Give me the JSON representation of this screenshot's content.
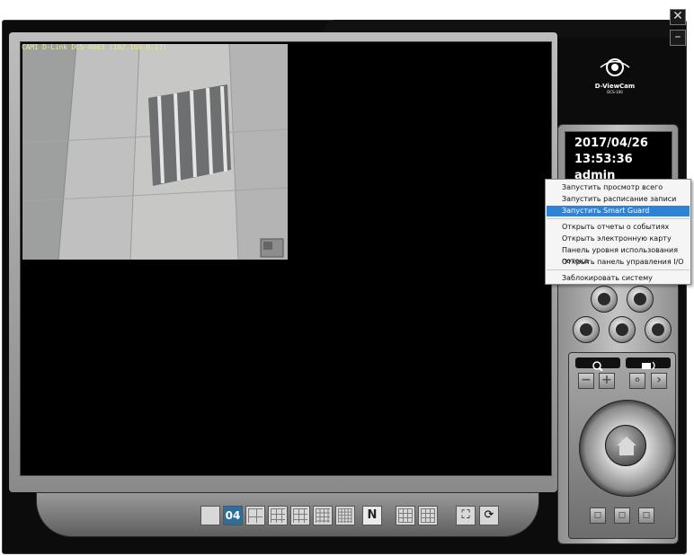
{
  "camera": {
    "label": "CAM1 D-Link DCS-4603 (192.168.0.17)"
  },
  "logo": {
    "name": "D-ViewCam",
    "model": "DCS-100"
  },
  "info": {
    "date": "2017/04/26",
    "time": "13:53:36",
    "user": "admin"
  },
  "menu": {
    "items": [
      "Запустить просмотр всего",
      "Запустить расписание записи",
      "Запустить Smart Guard",
      "Открыть отчеты о событиях",
      "Открыть электронную карту",
      "Панель уровня использования потока",
      "Открыть панель управления I/O",
      "Заблокировать систему"
    ],
    "highlighted_index": 2
  },
  "layout_bar": {
    "active_label": "04",
    "n_label": "N"
  },
  "window": {
    "close_glyph": "✕",
    "minimize_glyph": "–"
  },
  "ptz": {
    "zoom_minus": "−",
    "zoom_plus": "+"
  },
  "colors": {
    "menu_highlight": "#2f83d6",
    "active_layout": "#2d6e9a",
    "cam_label": "#e8ea8c"
  }
}
